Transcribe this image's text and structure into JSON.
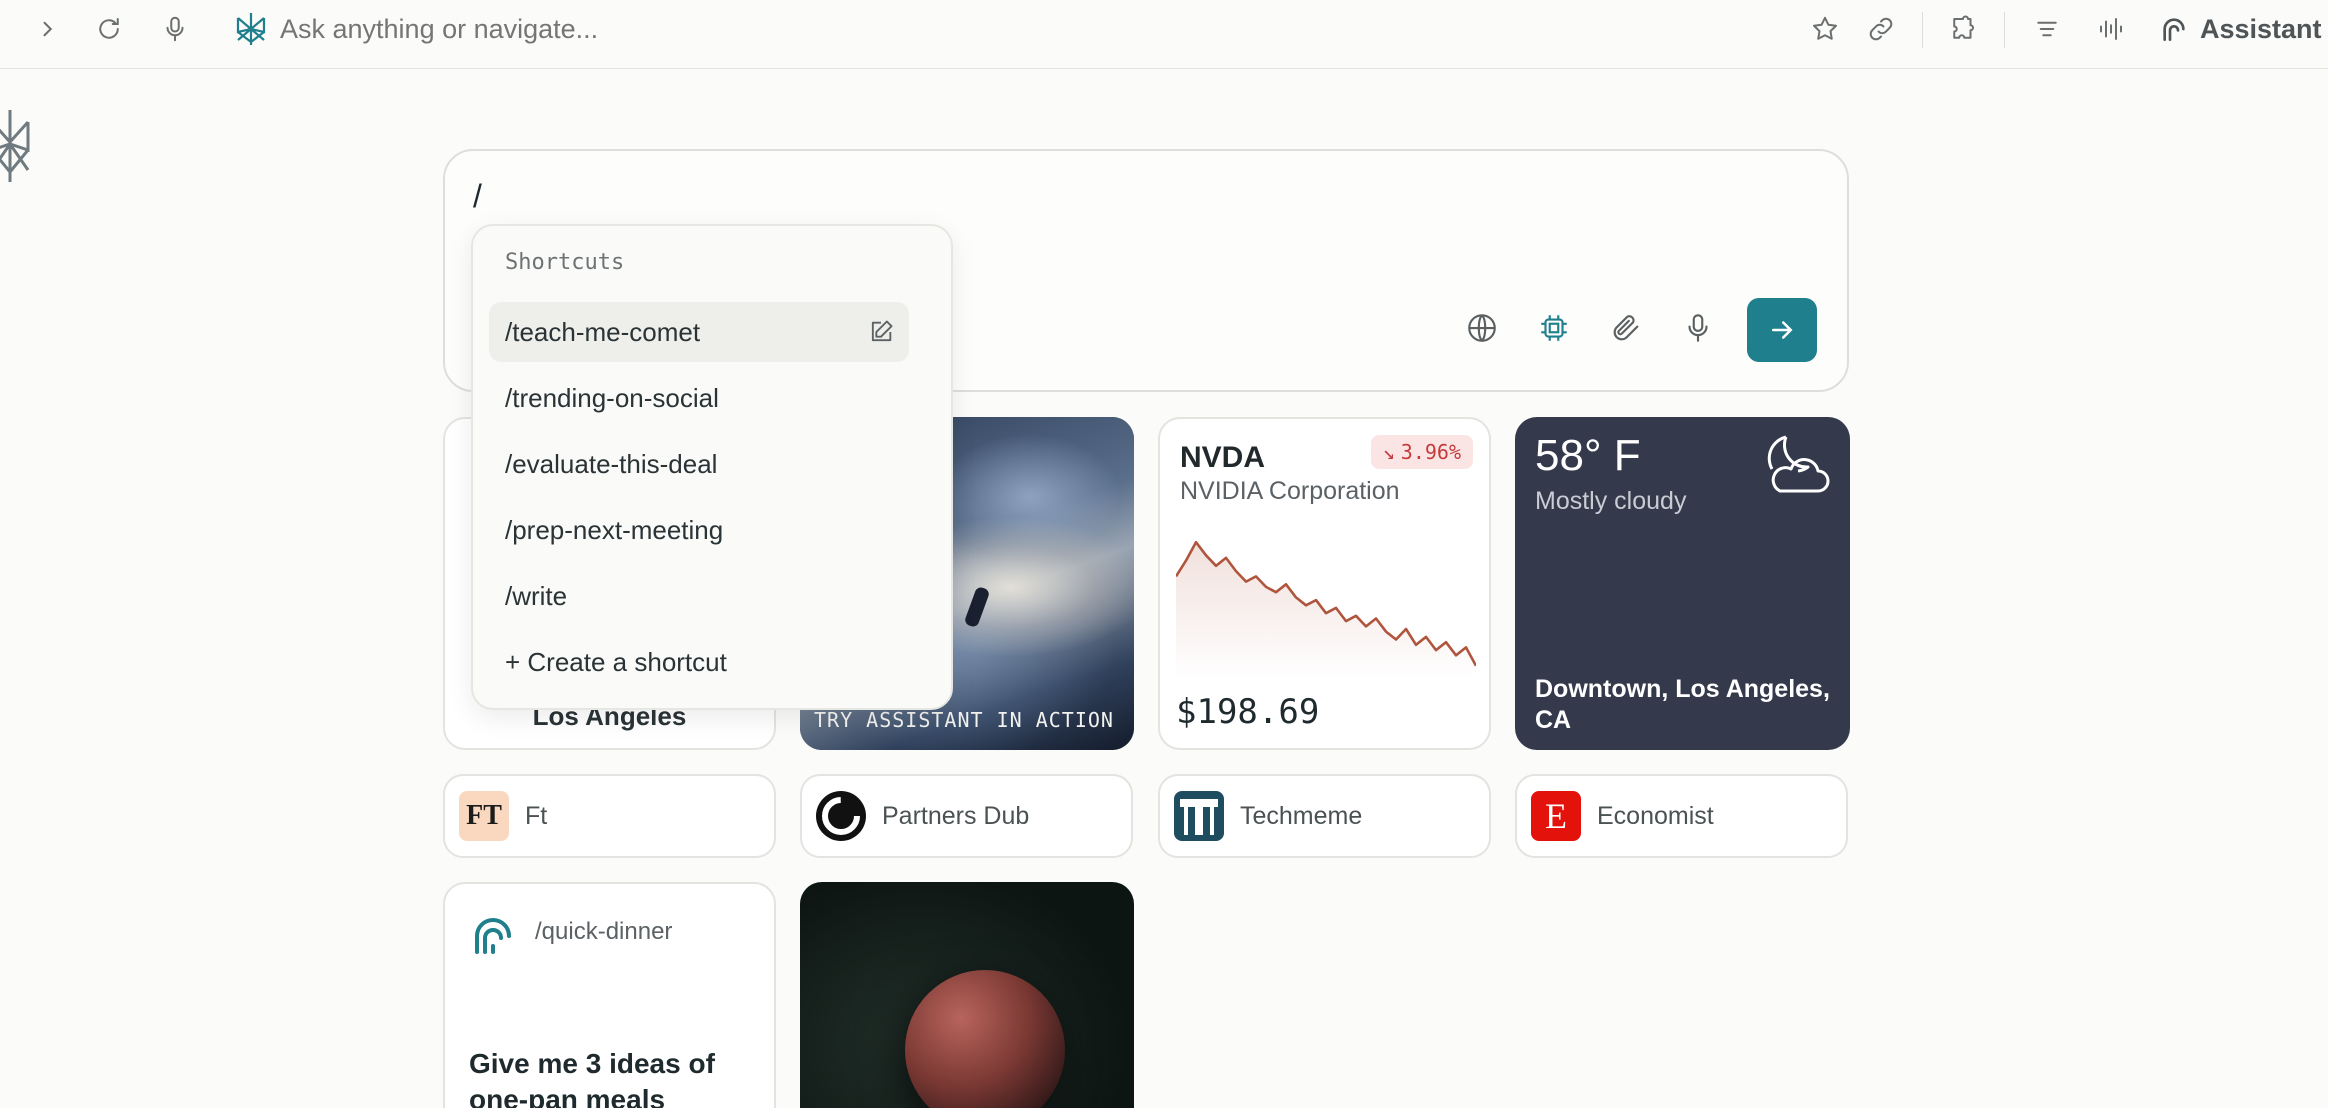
{
  "toolbar": {
    "omnibox_placeholder": "Ask anything or navigate...",
    "assistant_label": "Assistant",
    "accent_color": "#1f7f8c"
  },
  "search": {
    "value": "/"
  },
  "shortcuts": {
    "header": "Shortcuts",
    "items": [
      {
        "label": "/teach-me-comet"
      },
      {
        "label": "/trending-on-social"
      },
      {
        "label": "/evaluate-this-deal"
      },
      {
        "label": "/prep-next-meeting"
      },
      {
        "label": "/write"
      },
      {
        "label": "+ Create a shortcut"
      }
    ]
  },
  "cards": {
    "weather_behind": {
      "city": "Los Angeles"
    },
    "video": {
      "label": "TRY ASSISTANT IN ACTION"
    },
    "stock": {
      "ticker": "NVDA",
      "change": "3.96%",
      "change_direction": "down",
      "company": "NVIDIA Corporation",
      "price": "$198.69",
      "sparkline": [
        72,
        78,
        85,
        80,
        76,
        79,
        74,
        70,
        72,
        68,
        66,
        69,
        64,
        61,
        63,
        58,
        60,
        55,
        57,
        53,
        56,
        51,
        48,
        52,
        46,
        49,
        44,
        47,
        42,
        45,
        38
      ]
    },
    "weather": {
      "temp": "58° F",
      "condition": "Mostly cloudy",
      "location": "Downtown, Los Angeles, CA"
    }
  },
  "sites": [
    {
      "name": "Ft",
      "logo_text": "FT"
    },
    {
      "name": "Partners Dub"
    },
    {
      "name": "Techmeme"
    },
    {
      "name": "Economist",
      "logo_text": "E"
    }
  ],
  "dinner": {
    "command": "/quick-dinner",
    "prompt": "Give me 3 ideas of one-pan meals"
  }
}
